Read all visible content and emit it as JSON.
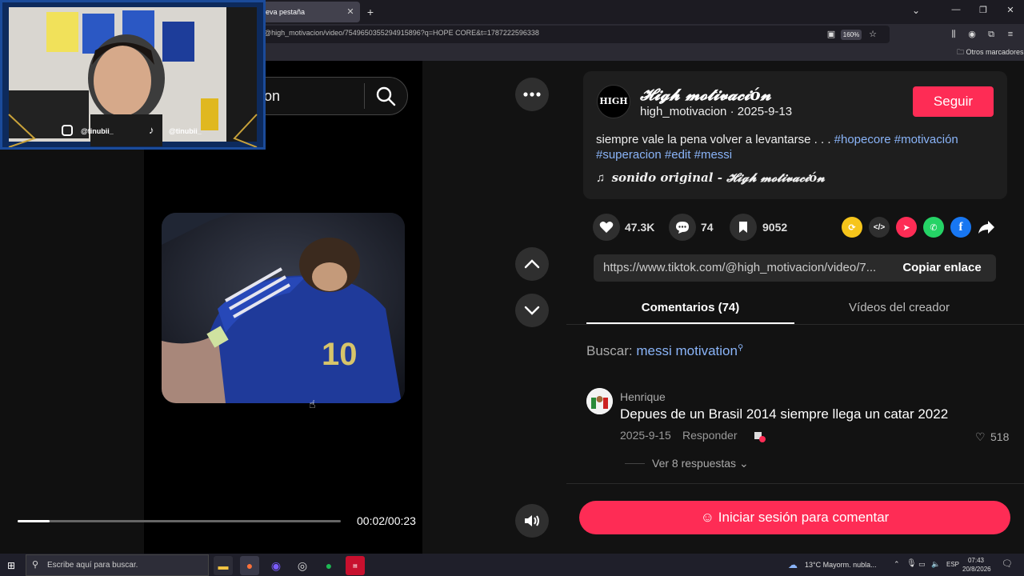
{
  "browser": {
    "tab_title": "eva pestaña",
    "url": "@high_motivacion/video/7549650355294915896?q=HOPE CORE&t=1787222596338",
    "zoom": "160%",
    "bookmarks_other": "Otros marcadores"
  },
  "search": {
    "value": "on"
  },
  "video": {
    "time": "00:02/00:23",
    "progress": 0.1
  },
  "creator": {
    "display_name": "𝓗𝓲𝓰𝓱 𝓶𝓸𝓽𝓲𝓿𝓪𝓬𝓲ó𝓷",
    "meta": "high_motivacion · 2025-9-13",
    "avatar_text": "HIGH",
    "follow_label": "Seguir"
  },
  "caption": {
    "text": "siempre vale la pena volver a levantarse . . . ",
    "hashtags_line1": [
      "#hopecore",
      "#motivación"
    ],
    "hashtags_line2": [
      "#superacion",
      "#edit",
      "#messi"
    ],
    "sound": "sonido original - 𝓗𝓲𝓰𝓱 𝓶𝓸𝓽𝓲𝓿𝓪𝓬𝓲ó𝓷"
  },
  "actions": {
    "likes": "47.3K",
    "comments": "74",
    "saves": "9052"
  },
  "share": {
    "link": "https://www.tiktok.com/@high_motivacion/video/7...",
    "copy_label": "Copiar enlace"
  },
  "tabs": {
    "comments": "Comentarios (74)",
    "creator_videos": "Vídeos del creador"
  },
  "related_search": {
    "prefix": "Buscar:",
    "term": "messi motivation"
  },
  "comment": {
    "user": "Henrique",
    "text": "Depues de un Brasil 2014 siempre llega un catar 2022",
    "date": "2025-9-15",
    "reply": "Responder",
    "likes": "518",
    "view_replies": "Ver 8 respuestas"
  },
  "login_comment": "Iniciar sesión para comentar",
  "webcam": {
    "handle1": "@tinubii_",
    "handle2": "@tinubii_"
  },
  "taskbar": {
    "search_placeholder": "Escribe aquí para buscar.",
    "weather": "13°C  Mayorm. nubla...",
    "lang": "ESP",
    "time": "07:43",
    "date": "20/8/2026"
  },
  "colors": {
    "accent": "#fe2c55",
    "link": "#8ab4f8",
    "panel": "#121212"
  }
}
